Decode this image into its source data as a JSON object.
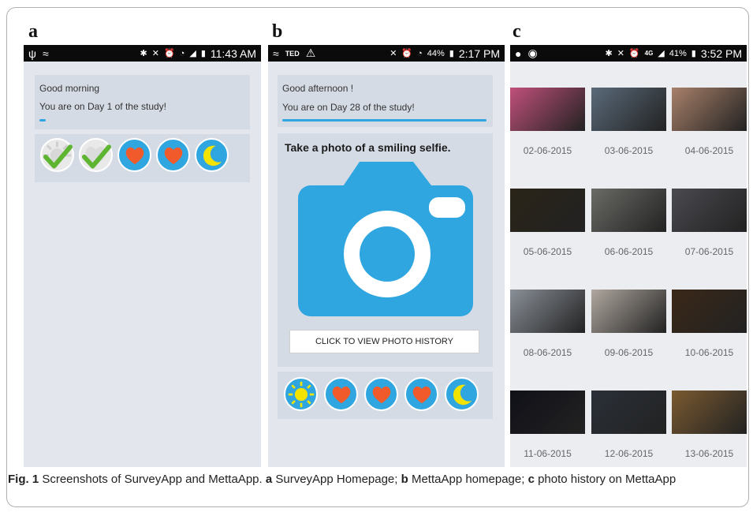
{
  "panels": {
    "a": {
      "letter": "a",
      "status": {
        "time": "11:43 AM"
      },
      "greeting": "Good morning",
      "day_text": "You are on Day 1 of the study!",
      "progress": 0.03,
      "icons": [
        "sun-check-icon",
        "sun-check-icon",
        "heart-icon",
        "heart-icon",
        "moon-icon"
      ]
    },
    "b": {
      "letter": "b",
      "status": {
        "carrier": "TED",
        "battery": "44%",
        "time": "2:17 PM"
      },
      "greeting": "Good afternoon !",
      "day_text": "You are on Day 28 of the study!",
      "progress": 1.0,
      "prompt": "Take a photo of a smiling selfie.",
      "history_button": "CLICK TO VIEW PHOTO HISTORY",
      "icons": [
        "sun-icon",
        "heart-icon",
        "heart-icon",
        "heart-icon",
        "moon-icon"
      ]
    },
    "c": {
      "letter": "c",
      "status": {
        "network": "4G",
        "battery": "41%",
        "time": "3:52 PM"
      },
      "photos": [
        {
          "date": "02-06-2015",
          "color": "#c0507a"
        },
        {
          "date": "03-06-2015",
          "color": "#5a6a7a"
        },
        {
          "date": "04-06-2015",
          "color": "#a8806a"
        },
        {
          "date": "05-06-2015",
          "color": "#2a2418"
        },
        {
          "date": "06-06-2015",
          "color": "#6a6a66"
        },
        {
          "date": "07-06-2015",
          "color": "#4a4a50"
        },
        {
          "date": "08-06-2015",
          "color": "#8a9098"
        },
        {
          "date": "09-06-2015",
          "color": "#b0a8a0"
        },
        {
          "date": "10-06-2015",
          "color": "#3a2818"
        },
        {
          "date": "11-06-2015",
          "color": "#101018"
        },
        {
          "date": "12-06-2015",
          "color": "#2a3038"
        },
        {
          "date": "13-06-2015",
          "color": "#7a5a30"
        }
      ]
    }
  },
  "caption": {
    "fig": "Fig. 1",
    "text1": " Screenshots of SurveyApp and MettaApp. ",
    "a": "a",
    "text2": " SurveyApp Homepage; ",
    "b": "b",
    "text3": " MettaApp homepage; ",
    "c": "c",
    "text4": " photo history on MettaApp"
  },
  "colors": {
    "accent": "#2fa6e0",
    "heart": "#f15a2a",
    "moon": "#f2e400",
    "check": "#5db531",
    "card": "#d5dbe5",
    "screen": "#e3e6ec"
  }
}
